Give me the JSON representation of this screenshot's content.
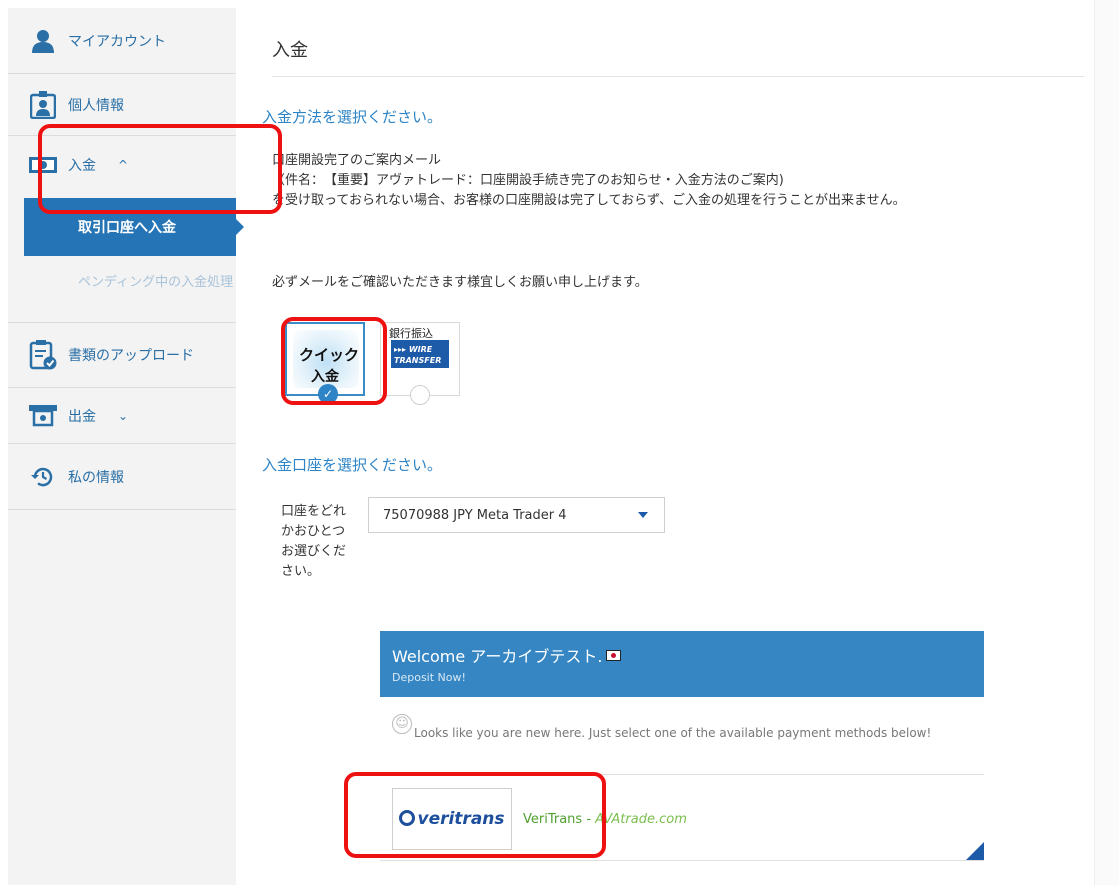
{
  "sidebar": {
    "items": [
      {
        "label": "マイアカウント",
        "icon": "user-icon"
      },
      {
        "label": "個人情報",
        "icon": "id-badge-icon"
      },
      {
        "label": "入金",
        "icon": "cash-icon",
        "chevron": "^"
      },
      {
        "label": "書類のアップロード",
        "icon": "document-check-icon"
      },
      {
        "label": "出金",
        "icon": "withdraw-icon",
        "chevron": "⌄"
      },
      {
        "label": "私の情報",
        "icon": "history-icon"
      }
    ],
    "sub_items": {
      "active": "取引口座へ入金",
      "pending": "ペンディング中の入金処理"
    }
  },
  "main": {
    "title": "入金",
    "method_heading": "入金方法を選択ください。",
    "notice": {
      "line1": "口座開設完了のご案内メール",
      "line2": "（件名：　【重要】アヴァトレード：口座開設手続き完了のお知らせ・入金方法のご案内)",
      "line3": "を受け取っておられない場合、お客様の口座開設は完了しておらず、ご入金の処理を行うことが出来ません。"
    },
    "confirm": "必ずメールをご確認いただきます様宜しくお願い申し上げます。",
    "methods": {
      "quick_line1": "クイック",
      "quick_line2": "入金",
      "wire_top": "銀行振込",
      "wire_line1": "▸▸▸ WIRE",
      "wire_line2": "TRANSFER"
    },
    "account_heading": "入金口座を選択ください。",
    "account_label": "口座をどれかおひとつお選びください。",
    "account_value": "75070988 JPY Meta Trader 4",
    "widget": {
      "welcome": "Welcome アーカイブテスト.",
      "deposit_now": "Deposit Now!",
      "new_here": "Looks like you are new here. Just select one of the available payment methods below!",
      "provider_logo": "veritrans",
      "provider_name": "VeriTrans - ",
      "provider_domain": "AVAtrade.com"
    }
  },
  "colors": {
    "accent": "#2574b5",
    "link": "#2d84c6",
    "highlight": "#ee1111",
    "green": "#4fa02f"
  }
}
